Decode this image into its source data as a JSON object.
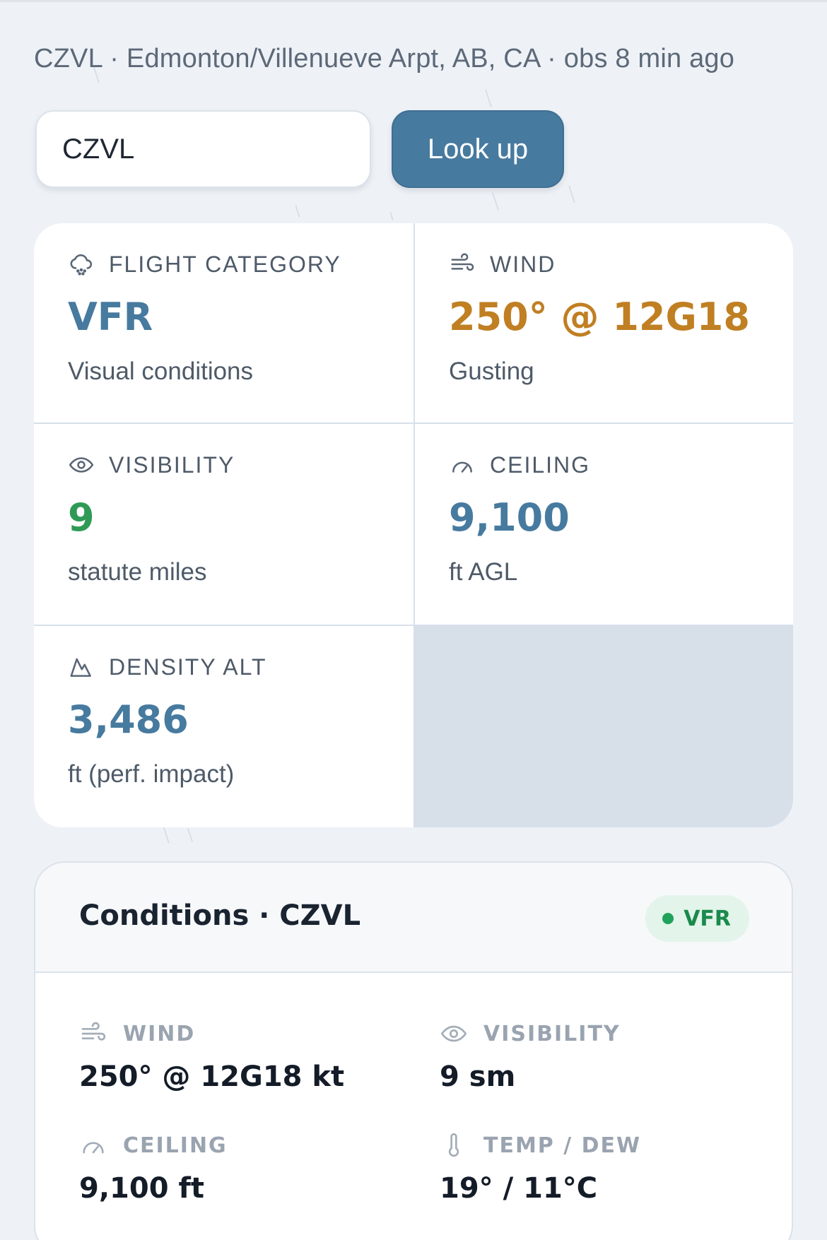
{
  "header": {
    "station_line": "CZVL · Edmonton/Villenueve Arpt, AB, CA · obs 8 min ago"
  },
  "search": {
    "value": "CZVL",
    "button_label": "Look up"
  },
  "tiles": {
    "flight_category": {
      "label": "FLIGHT CATEGORY",
      "value": "VFR",
      "sub": "Visual conditions",
      "icon": "cloud-rain-icon",
      "color": "#477a9f"
    },
    "wind": {
      "label": "WIND",
      "value": "250° @ 12G18",
      "sub": "Gusting",
      "icon": "wind-icon",
      "color": "#c07f23"
    },
    "visibility": {
      "label": "VISIBILITY",
      "value": "9",
      "sub": "statute miles",
      "icon": "eye-icon",
      "color": "#2f9a55"
    },
    "ceiling": {
      "label": "CEILING",
      "value": "9,100",
      "sub": "ft AGL",
      "icon": "gauge-icon",
      "color": "#477a9f"
    },
    "density_alt": {
      "label": "DENSITY ALT",
      "value": "3,486",
      "sub": "ft (perf. impact)",
      "icon": "mountain-icon",
      "color": "#477a9f"
    }
  },
  "conditions": {
    "title": "Conditions · CZVL",
    "badge": "VFR",
    "items": [
      {
        "label": "WIND",
        "value": "250° @ 12G18 kt",
        "icon": "wind-icon"
      },
      {
        "label": "VISIBILITY",
        "value": "9 sm",
        "icon": "eye-icon"
      },
      {
        "label": "CEILING",
        "value": "9,100 ft",
        "icon": "gauge-icon"
      },
      {
        "label": "TEMP / DEW",
        "value": "19° / 11°C",
        "icon": "thermometer-icon"
      }
    ]
  }
}
